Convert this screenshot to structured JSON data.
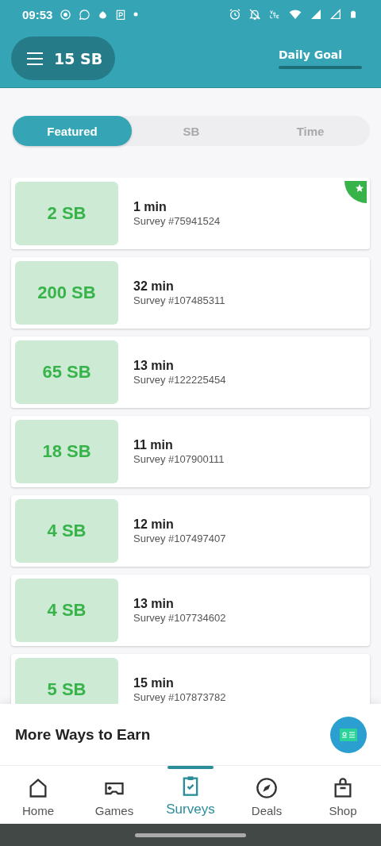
{
  "status_bar": {
    "time": "09:53"
  },
  "header": {
    "balance": "15 SB",
    "daily_goal": {
      "label": "Daily Goal"
    }
  },
  "tabs": [
    {
      "label": "Featured",
      "selected": true
    },
    {
      "label": "SB",
      "selected": false
    },
    {
      "label": "Time",
      "selected": false
    }
  ],
  "surveys": [
    {
      "reward": "2 SB",
      "duration": "1 min",
      "title": "Survey #75941524",
      "featured": true
    },
    {
      "reward": "200 SB",
      "duration": "32 min",
      "title": "Survey #107485311",
      "featured": false
    },
    {
      "reward": "65 SB",
      "duration": "13 min",
      "title": "Survey #122225454",
      "featured": false
    },
    {
      "reward": "18 SB",
      "duration": "11 min",
      "title": "Survey #107900111",
      "featured": false
    },
    {
      "reward": "4 SB",
      "duration": "12 min",
      "title": "Survey #107497407",
      "featured": false
    },
    {
      "reward": "4 SB",
      "duration": "13 min",
      "title": "Survey #107734602",
      "featured": false
    },
    {
      "reward": "5 SB",
      "duration": "15 min",
      "title": "Survey #107873782",
      "featured": false
    }
  ],
  "more_ways": {
    "title": "More Ways to Earn"
  },
  "nav": [
    {
      "label": "Home",
      "selected": false,
      "kind": "home"
    },
    {
      "label": "Games",
      "selected": false,
      "kind": "games"
    },
    {
      "label": "Surveys",
      "selected": true,
      "kind": "surveys"
    },
    {
      "label": "Deals",
      "selected": false,
      "kind": "deals"
    },
    {
      "label": "Shop",
      "selected": false,
      "kind": "shop"
    }
  ]
}
